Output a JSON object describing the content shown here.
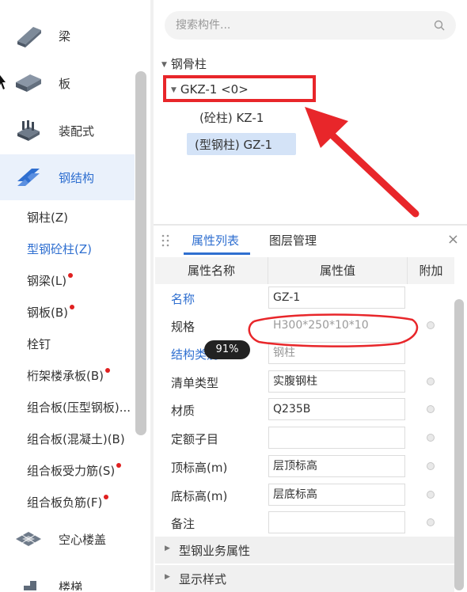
{
  "left_nav": {
    "categories_top": [
      {
        "label": "梁",
        "icon": "beam-icon"
      },
      {
        "label": "板",
        "icon": "slab-icon"
      },
      {
        "label": "装配式",
        "icon": "prefab-icon"
      },
      {
        "label": "钢结构",
        "icon": "steel-structure-icon",
        "active": true
      }
    ],
    "sub_items": [
      {
        "label": "钢柱(Z)",
        "dot": false
      },
      {
        "label": "型钢砼柱(Z)",
        "dot": false,
        "active": true
      },
      {
        "label": "钢梁(L)",
        "dot": true
      },
      {
        "label": "钢板(B)",
        "dot": true
      },
      {
        "label": "栓钉",
        "dot": false
      },
      {
        "label": "桁架楼承板(B)",
        "dot": true
      },
      {
        "label": "组合板(压型钢板)...",
        "dot": false
      },
      {
        "label": "组合板(混凝土)(B)",
        "dot": false
      },
      {
        "label": "组合板受力筋(S)",
        "dot": true
      },
      {
        "label": "组合板负筋(F)",
        "dot": true
      }
    ],
    "categories_bottom": [
      {
        "label": "空心楼盖",
        "icon": "hollow-floor-icon"
      },
      {
        "label": "楼梯",
        "icon": "stairs-icon"
      }
    ]
  },
  "search": {
    "placeholder": "搜索构件..."
  },
  "tree": {
    "root": "钢骨柱",
    "child": "GKZ-1 <0>",
    "leaves": [
      "(砼柱) KZ-1",
      "(型钢柱) GZ-1"
    ]
  },
  "properties_panel": {
    "tabs": [
      "属性列表",
      "图层管理"
    ],
    "close": "×",
    "headers": [
      "属性名称",
      "属性值",
      "附加"
    ],
    "rows": [
      {
        "name": "名称",
        "value": "GZ-1",
        "blue": true,
        "radio": false
      },
      {
        "name": "规格",
        "value": "H300*250*10*10",
        "blue": false,
        "radio": true,
        "gray": true
      },
      {
        "name": "结构类别",
        "value": "钢柱",
        "blue": true,
        "radio": false,
        "gray": true
      },
      {
        "name": "清单类型",
        "value": "实腹钢柱",
        "blue": false,
        "radio": true
      },
      {
        "name": "材质",
        "value": "Q235B",
        "blue": false,
        "radio": true
      },
      {
        "name": "定额子目",
        "value": "",
        "blue": false,
        "radio": true
      },
      {
        "name": "顶标高(m)",
        "value": "层顶标高",
        "blue": false,
        "radio": true
      },
      {
        "name": "底标高(m)",
        "value": "层底标高",
        "blue": false,
        "radio": true
      },
      {
        "name": "备注",
        "value": "",
        "blue": false,
        "radio": true
      }
    ],
    "sections": [
      "型钢业务属性",
      "显示样式"
    ]
  },
  "zoom_badge": "91%",
  "colors": {
    "accent": "#2f6fd0",
    "annotation": "#e8262a",
    "selection": "#d4e3f7"
  }
}
